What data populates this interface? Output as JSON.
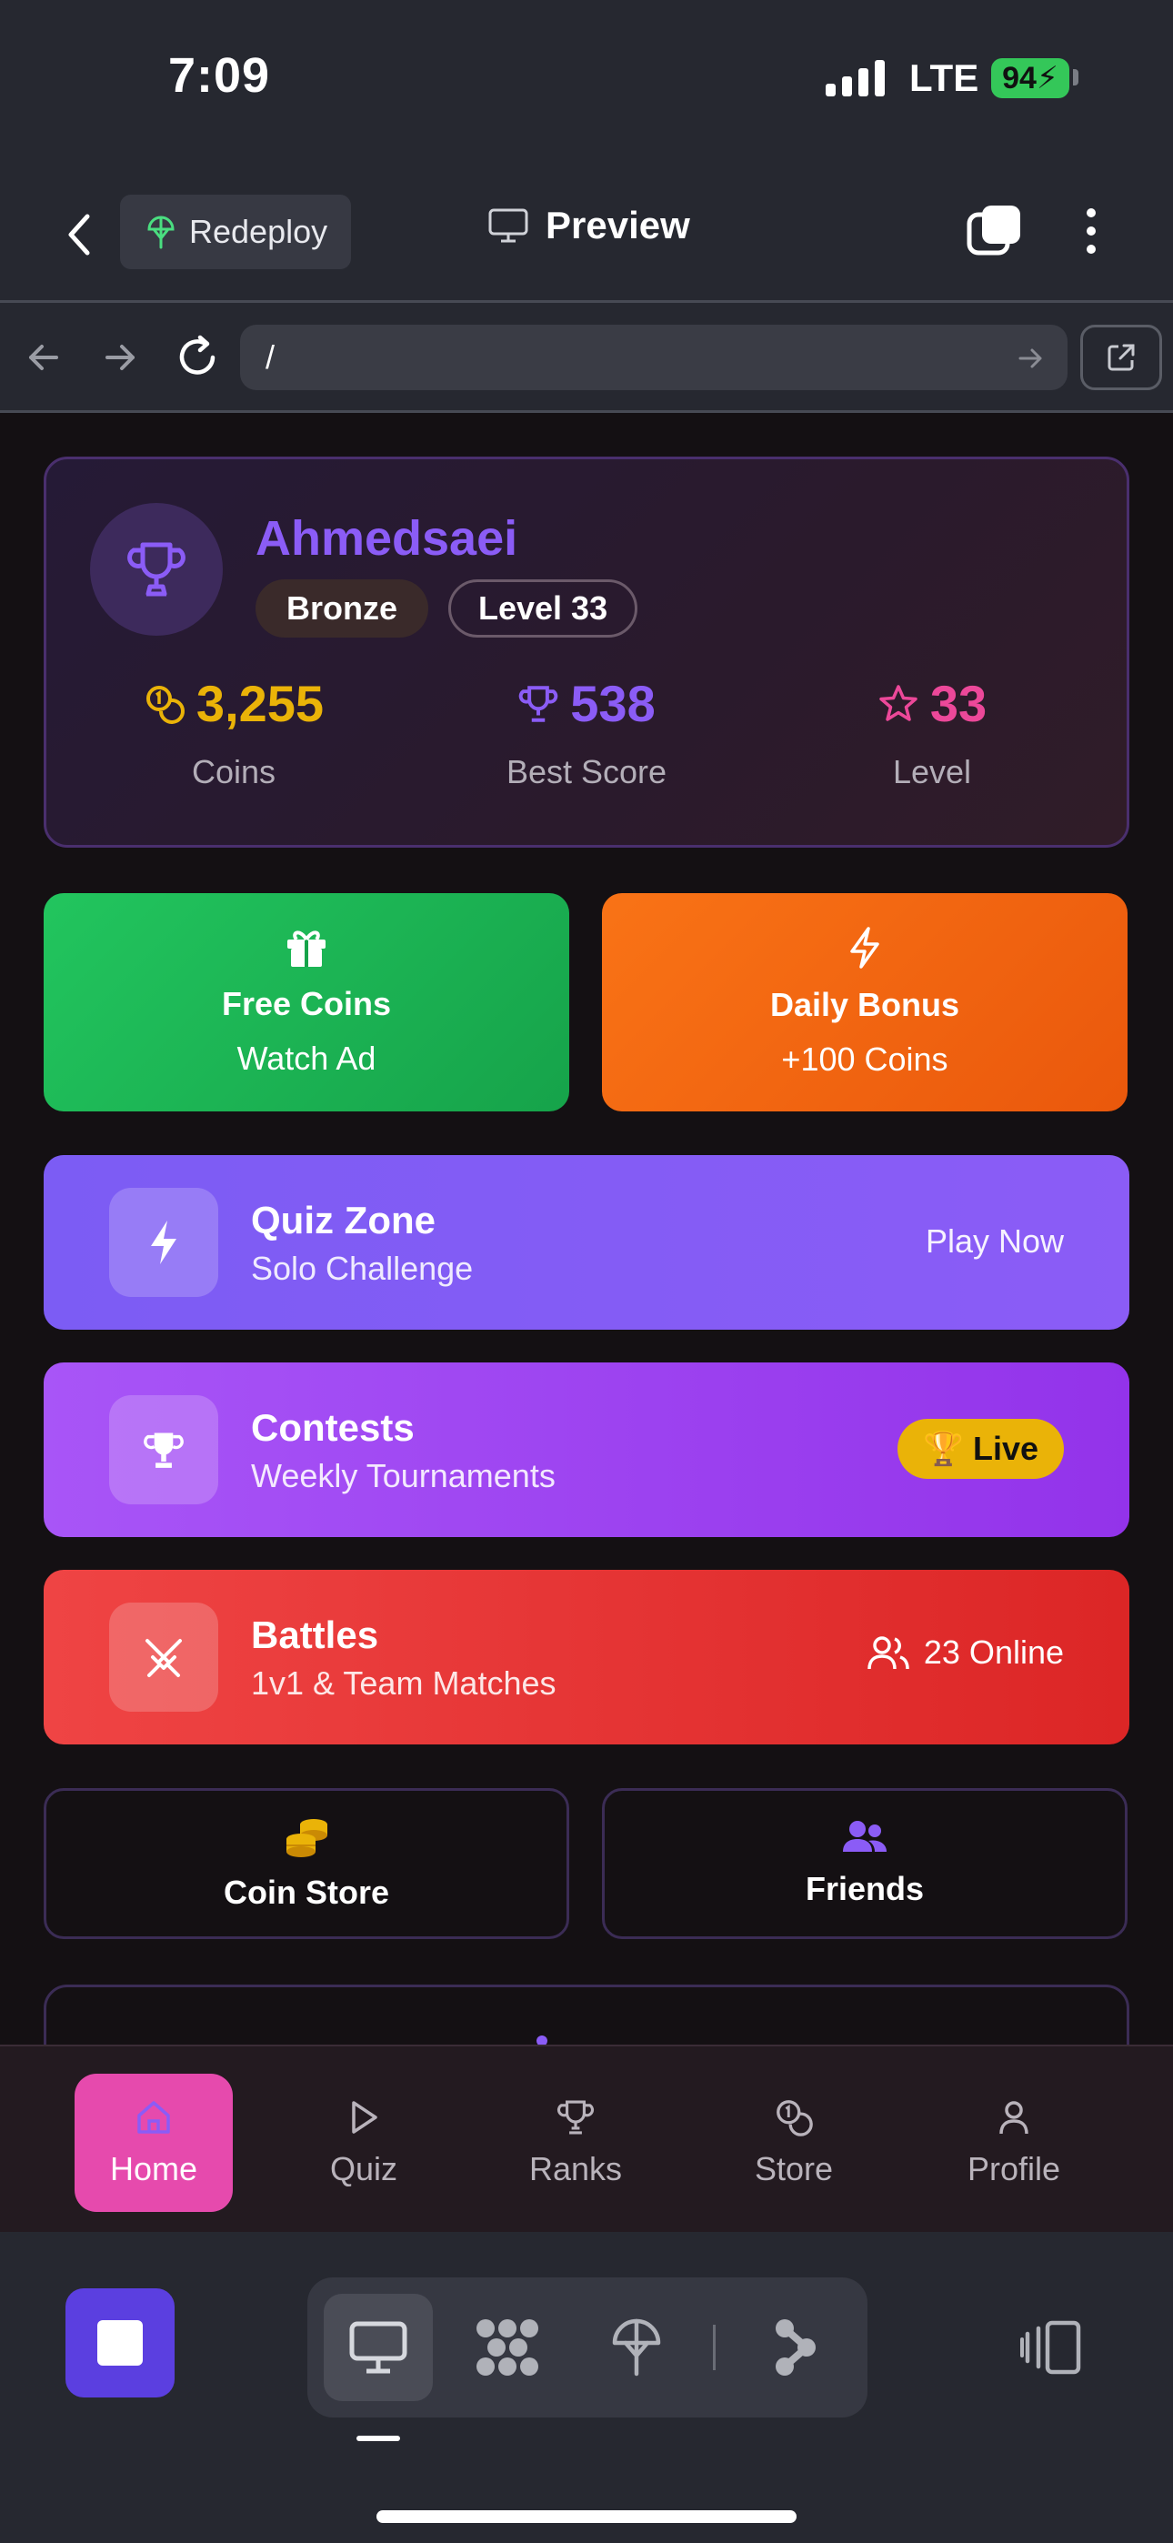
{
  "status_bar": {
    "time": "7:09",
    "network": "LTE",
    "battery": "94"
  },
  "top_bar": {
    "redeploy_label": "Redeploy",
    "preview_label": "Preview"
  },
  "url_bar": {
    "url": "/"
  },
  "profile": {
    "username": "Ahmedsaei",
    "tier": "Bronze",
    "level_badge": "Level 33",
    "stats": [
      {
        "value": "3,255",
        "label": "Coins",
        "icon": "coins-icon",
        "color": "#eab308"
      },
      {
        "value": "538",
        "label": "Best Score",
        "icon": "trophy-icon",
        "color": "#8b5cf6"
      },
      {
        "value": "33",
        "label": "Level",
        "icon": "star-icon",
        "color": "#ec4899"
      }
    ]
  },
  "promos": {
    "free_coins": {
      "title": "Free Coins",
      "subtitle": "Watch Ad",
      "icon": "gift-icon"
    },
    "daily_bonus": {
      "title": "Daily Bonus",
      "subtitle": "+100 Coins",
      "icon": "lightning-icon"
    }
  },
  "modes": {
    "quiz": {
      "title": "Quiz Zone",
      "subtitle": "Solo Challenge",
      "action": "Play Now"
    },
    "contests": {
      "title": "Contests",
      "subtitle": "Weekly Tournaments",
      "badge": "Live",
      "badge_emoji": "🏆"
    },
    "battles": {
      "title": "Battles",
      "subtitle": "1v1 & Team Matches",
      "online": "23 Online"
    }
  },
  "tiles": {
    "coin_store": "Coin Store",
    "friends": "Friends"
  },
  "app_nav": {
    "items": [
      "Home",
      "Quiz",
      "Ranks",
      "Store",
      "Profile"
    ],
    "active": "Home"
  },
  "colors": {
    "accent": "#8b5cf6",
    "active_nav": "#e64aad",
    "live": "#eab308"
  }
}
